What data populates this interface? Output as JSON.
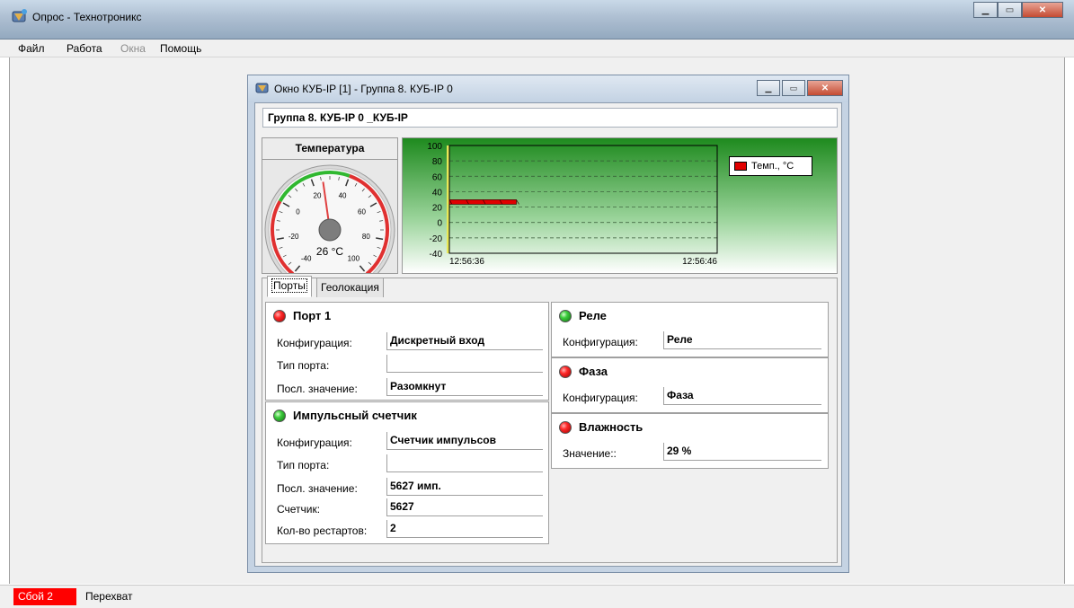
{
  "app": {
    "title": "Опрос - Технотроникс"
  },
  "menu": {
    "file": "Файл",
    "work": "Работа",
    "windows": "Окна",
    "help": "Помощь"
  },
  "window": {
    "title": "Окно КУБ-IP [1] -  Группа 8. КУБ-IP 0",
    "group_name": "Группа 8. КУБ-IP 0 _КУБ-IP"
  },
  "gauge": {
    "header": "Температура",
    "value": 26,
    "value_label": "26 °C",
    "min": -40,
    "max": 100,
    "ticks": [
      "-40",
      "-20",
      "0",
      "20",
      "40",
      "60",
      "80",
      "100"
    ]
  },
  "chart_data": {
    "type": "line",
    "x": [
      "12:56:36",
      "12:56:46"
    ],
    "series": [
      {
        "name": "Темп., °C",
        "color": "#e00000",
        "points": [
          [
            0,
            26
          ],
          [
            0.25,
            26
          ]
        ]
      }
    ],
    "ylim": [
      -40,
      100
    ],
    "yticks": [
      "100",
      "80",
      "60",
      "40",
      "20",
      "0",
      "-20",
      "-40"
    ],
    "grid": true,
    "legend": "top-right"
  },
  "tabs": [
    {
      "label": "Порты",
      "active": true
    },
    {
      "label": "Геолокация",
      "active": false
    }
  ],
  "ports": {
    "port1": {
      "title": "Порт 1",
      "status": "red",
      "config_label": "Конфигурация:",
      "config_value": "Дискретный вход",
      "type_label": "Тип порта:",
      "type_value": "",
      "last_label": "Посл. значение:",
      "last_value": "Разомкнут"
    },
    "counter": {
      "title": "Импульсный счетчик",
      "status": "green",
      "config_label": "Конфигурация:",
      "config_value": "Счетчик импульсов",
      "type_label": "Тип порта:",
      "type_value": "",
      "last_label": "Посл. значение:",
      "last_value": "5627 имп.",
      "count_label": "Счетчик:",
      "count_value": "5627",
      "restarts_label": "Кол-во рестартов:",
      "restarts_value": "2"
    },
    "relay": {
      "title": "Реле",
      "status": "green",
      "config_label": "Конфигурация:",
      "config_value": "Реле"
    },
    "phase": {
      "title": "Фаза",
      "status": "red",
      "config_label": "Конфигурация:",
      "config_value": "Фаза"
    },
    "humidity": {
      "title": "Влажность",
      "status": "red",
      "value_label": "Значение::",
      "value": "29 %"
    }
  },
  "status": {
    "error": "Сбой 2",
    "capture": "Перехват"
  }
}
